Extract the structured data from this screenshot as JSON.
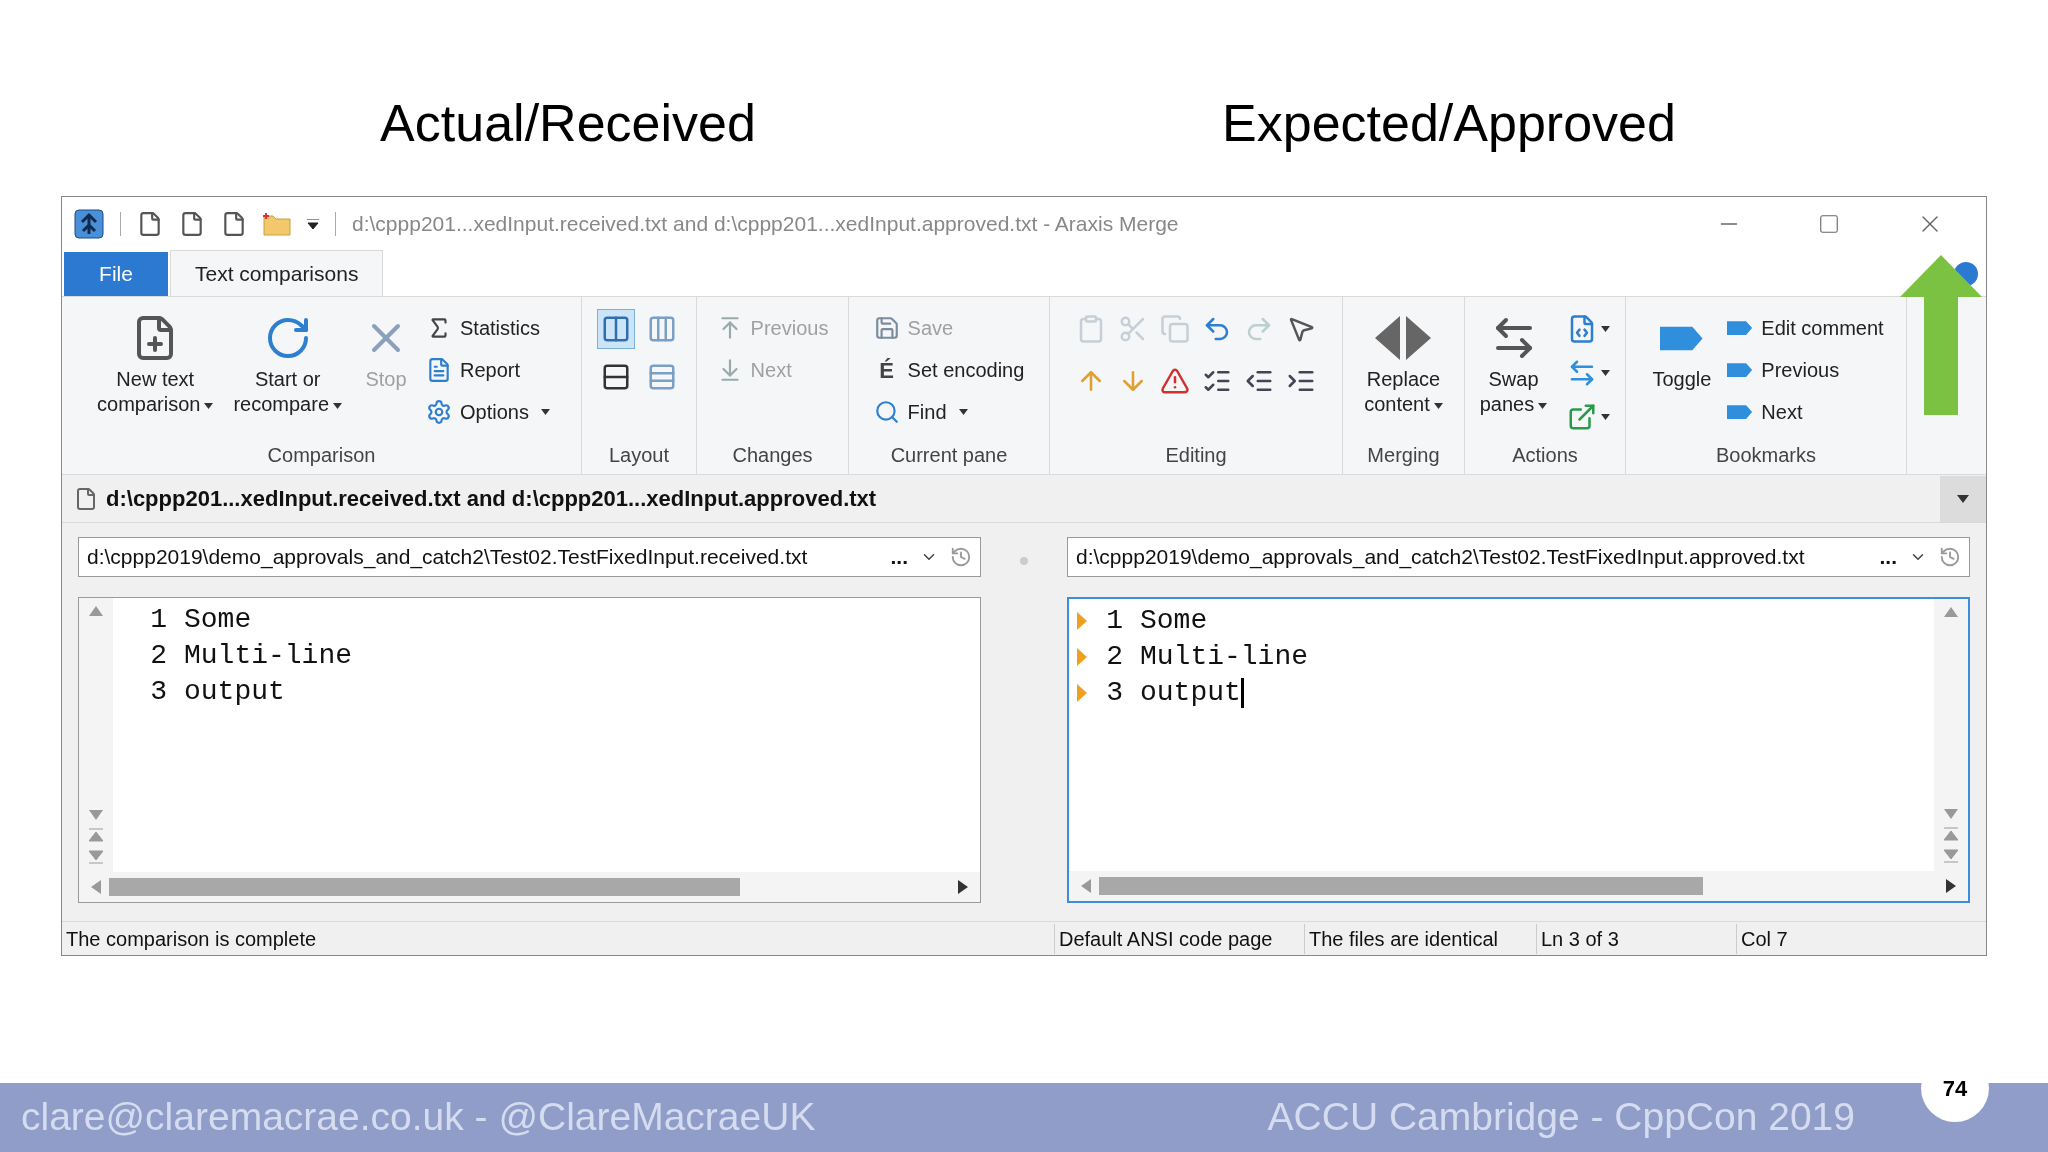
{
  "slide": {
    "headings": [
      "Actual/Received",
      "Expected/Approved"
    ],
    "footer_left": "clare@claremacrae.co.uk - @ClareMacraeUK",
    "footer_right": "ACCU Cambridge - CppCon 2019",
    "page_number": "74"
  },
  "window": {
    "title": "d:\\cppp201...xedInput.received.txt and d:\\cppp201...xedInput.approved.txt - Araxis Merge"
  },
  "tabs": [
    {
      "label": "File",
      "selected": false,
      "kind": "file"
    },
    {
      "label": "Text comparisons",
      "selected": true,
      "kind": "tab"
    }
  ],
  "ribbon": [
    {
      "label": "Comparison",
      "items": [
        {
          "kind": "large",
          "lines": [
            "New text",
            "comparison"
          ],
          "dropdown": true,
          "disabled": false
        },
        {
          "kind": "large",
          "lines": [
            "Start or",
            "recompare"
          ],
          "dropdown": true,
          "disabled": false
        },
        {
          "kind": "large",
          "lines": [
            "Stop"
          ],
          "dropdown": false,
          "disabled": true
        },
        {
          "kind": "small",
          "label": "Statistics",
          "dropdown": false,
          "disabled": false
        },
        {
          "kind": "small",
          "label": "Report",
          "dropdown": false,
          "disabled": false
        },
        {
          "kind": "small",
          "label": "Options",
          "dropdown": true,
          "disabled": false
        }
      ]
    },
    {
      "label": "Layout",
      "items": [
        {
          "kind": "toggle",
          "selected": true
        },
        {
          "kind": "toggle",
          "selected": false
        },
        {
          "kind": "toggle",
          "selected": false
        },
        {
          "kind": "toggle",
          "selected": false
        }
      ]
    },
    {
      "label": "Changes",
      "items": [
        {
          "kind": "small",
          "label": "Previous",
          "dropdown": false,
          "disabled": true
        },
        {
          "kind": "small",
          "label": "Next",
          "dropdown": false,
          "disabled": true
        }
      ]
    },
    {
      "label": "Current pane",
      "items": [
        {
          "kind": "small",
          "label": "Save",
          "dropdown": false,
          "disabled": true
        },
        {
          "kind": "small",
          "label": "Set encoding",
          "glyph": "É",
          "dropdown": false,
          "disabled": false
        },
        {
          "kind": "small",
          "label": "Find",
          "dropdown": true,
          "disabled": false
        }
      ]
    },
    {
      "label": "Editing",
      "items": [
        {
          "kind": "icon",
          "disabled": true,
          "dropdown": false
        },
        {
          "kind": "icon",
          "disabled": true,
          "dropdown": false
        },
        {
          "kind": "icon",
          "disabled": true,
          "dropdown": false
        },
        {
          "kind": "icon",
          "disabled": false,
          "dropdown": false
        },
        {
          "kind": "icon",
          "disabled": true,
          "dropdown": false
        },
        {
          "kind": "icon",
          "disabled": false,
          "dropdown": false
        },
        {
          "kind": "icon",
          "disabled": false,
          "dropdown": false
        },
        {
          "kind": "icon",
          "disabled": false,
          "dropdown": false
        },
        {
          "kind": "icon",
          "disabled": false,
          "dropdown": false
        },
        {
          "kind": "icon",
          "disabled": false,
          "dropdown": false
        },
        {
          "kind": "icon",
          "disabled": false,
          "dropdown": false
        },
        {
          "kind": "icon",
          "disabled": false,
          "dropdown": false
        }
      ]
    },
    {
      "label": "Merging",
      "items": [
        {
          "kind": "large",
          "lines": [
            "Replace",
            "content"
          ],
          "dropdown": true,
          "disabled": false
        }
      ]
    },
    {
      "label": "Actions",
      "items": [
        {
          "kind": "large",
          "lines": [
            "Swap",
            "panes"
          ],
          "dropdown": true,
          "disabled": false
        },
        {
          "kind": "icon",
          "disabled": false,
          "dropdown": true
        },
        {
          "kind": "icon",
          "disabled": false,
          "dropdown": true
        },
        {
          "kind": "icon",
          "disabled": false,
          "dropdown": true
        }
      ]
    },
    {
      "label": "Bookmarks",
      "items": [
        {
          "kind": "large",
          "lines": [
            "Toggle"
          ],
          "dropdown": false,
          "disabled": false
        },
        {
          "kind": "small",
          "label": "Edit comment",
          "dropdown": false,
          "disabled": false
        },
        {
          "kind": "small",
          "label": "Previous",
          "dropdown": false,
          "disabled": false
        },
        {
          "kind": "small",
          "label": "Next",
          "dropdown": false,
          "disabled": false
        }
      ]
    }
  ],
  "document_tab": "d:\\cppp201...xedInput.received.txt and d:\\cppp201...xedInput.approved.txt",
  "panes": [
    {
      "path": "d:\\cppp2019\\demo_approvals_and_catch2\\Test02.TestFixedInput.received.txt",
      "path_menu": "...",
      "focused": false,
      "lines": [
        {
          "number": "1",
          "text": "Some",
          "marked": false
        },
        {
          "number": "2",
          "text": "Multi-line",
          "marked": false
        },
        {
          "number": "3",
          "text": "output",
          "marked": false
        }
      ]
    },
    {
      "path": "d:\\cppp2019\\demo_approvals_and_catch2\\Test02.TestFixedInput.approved.txt",
      "path_menu": "...",
      "focused": true,
      "lines": [
        {
          "number": "1",
          "text": "Some",
          "marked": true
        },
        {
          "number": "2",
          "text": "Multi-line",
          "marked": true
        },
        {
          "number": "3",
          "text": "output",
          "marked": true
        }
      ]
    }
  ],
  "status_bar": [
    "The comparison is complete",
    "Default ANSI code page",
    "The files are identical",
    "Ln 3 of 3",
    "Col 7"
  ]
}
